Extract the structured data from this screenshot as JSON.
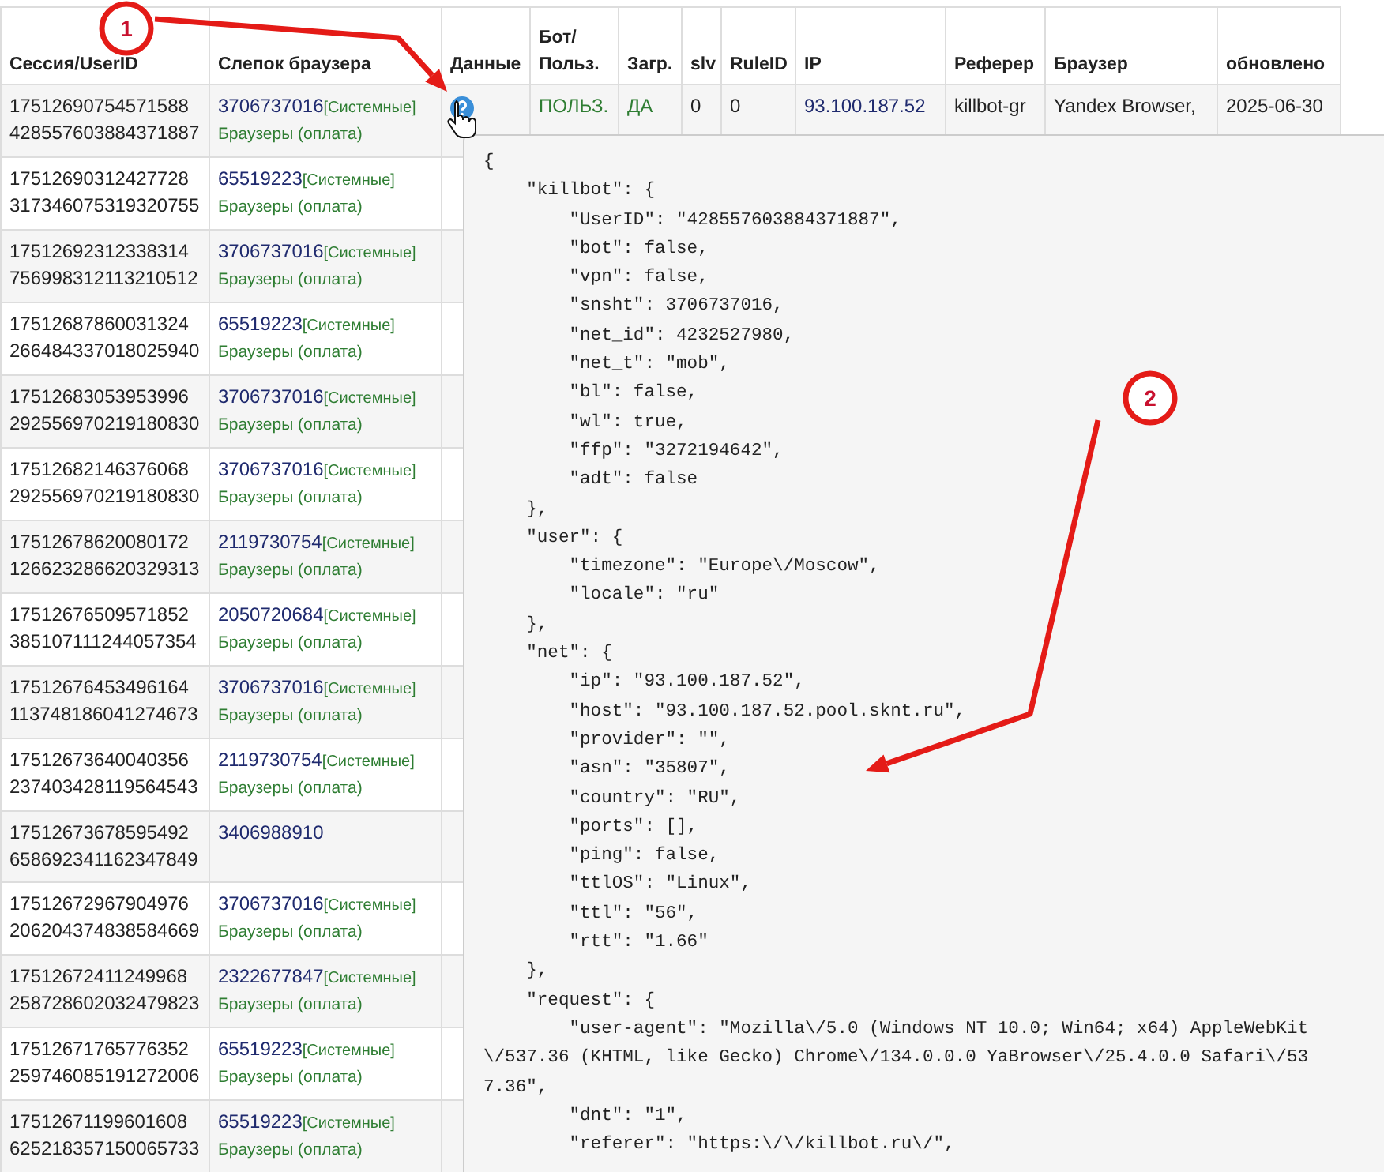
{
  "table": {
    "columns": [
      "Сессия/UserID",
      "Слепок браузера",
      "Данные",
      "Бот/ Польз.",
      "Загр.",
      "slv",
      "RuleID",
      "IP",
      "Реферер",
      "Браузер",
      "обновлено"
    ],
    "rows": [
      {
        "session": "17512690754571588",
        "user_id": "428557603884371887",
        "fingerprint": "3706737016",
        "tag": "[Системные]",
        "category": "Браузеры (оплата)",
        "bot_user": "ПОЛЬЗ.",
        "loaded": "ДА",
        "slv": "0",
        "rule_id": "0",
        "ip": "93.100.187.52",
        "referer": "killbot-gr",
        "browser": "Yandex Browser,",
        "updated": "2025-06-30"
      },
      {
        "session": "17512690312427728",
        "user_id": "317346075319320755",
        "fingerprint": "65519223",
        "tag": "[Системные]",
        "category": "Браузеры (оплата)"
      },
      {
        "session": "17512692312338314",
        "user_id": "756998312113210512",
        "fingerprint": "3706737016",
        "tag": "[Системные]",
        "category": "Браузеры (оплата)"
      },
      {
        "session": "17512687860031324",
        "user_id": "266484337018025940",
        "fingerprint": "65519223",
        "tag": "[Системные]",
        "category": "Браузеры (оплата)"
      },
      {
        "session": "17512683053953996",
        "user_id": "292556970219180830",
        "fingerprint": "3706737016",
        "tag": "[Системные]",
        "category": "Браузеры (оплата)"
      },
      {
        "session": "17512682146376068",
        "user_id": "292556970219180830",
        "fingerprint": "3706737016",
        "tag": "[Системные]",
        "category": "Браузеры (оплата)"
      },
      {
        "session": "17512678620080172",
        "user_id": "126623286620329313",
        "fingerprint": "2119730754",
        "tag": "[Системные]",
        "category": "Браузеры (оплата)"
      },
      {
        "session": "17512676509571852",
        "user_id": "385107111244057354",
        "fingerprint": "2050720684",
        "tag": "[Системные]",
        "category": "Браузеры (оплата)"
      },
      {
        "session": "17512676453496164",
        "user_id": "113748186041274673",
        "fingerprint": "3706737016",
        "tag": "[Системные]",
        "category": "Браузеры (оплата)"
      },
      {
        "session": "17512673640040356",
        "user_id": "237403428119564543",
        "fingerprint": "2119730754",
        "tag": "[Системные]",
        "category": "Браузеры (оплата)"
      },
      {
        "session": "17512673678595492",
        "user_id": "658692341162347849",
        "fingerprint": "3406988910"
      },
      {
        "session": "17512672967904976",
        "user_id": "206204374838584669",
        "fingerprint": "3706737016",
        "tag": "[Системные]",
        "category": "Браузеры (оплата)"
      },
      {
        "session": "17512672411249968",
        "user_id": "258728602032479823",
        "fingerprint": "2322677847",
        "tag": "[Системные]",
        "category": "Браузеры (оплата)"
      },
      {
        "session": "17512671765776352",
        "user_id": "259746085191272006",
        "fingerprint": "65519223",
        "tag": "[Системные]",
        "category": "Браузеры (оплата)"
      },
      {
        "session": "17512671199601608",
        "user_id": "625218357150065733",
        "fingerprint": "65519223",
        "tag": "[Системные]",
        "category": "Браузеры (оплата)"
      }
    ]
  },
  "popup": {
    "lines": [
      "{",
      "    \"killbot\": {",
      "        \"UserID\": \"428557603884371887\",",
      "        \"bot\": false,",
      "        \"vpn\": false,",
      "        \"snsht\": 3706737016,",
      "        \"net_id\": 4232527980,",
      "        \"net_t\": \"mob\",",
      "        \"bl\": false,",
      "        \"wl\": true,",
      "        \"ffp\": \"3272194642\",",
      "        \"adt\": false",
      "    },",
      "    \"user\": {",
      "        \"timezone\": \"Europe\\/Moscow\",",
      "        \"locale\": \"ru\"",
      "    },",
      "    \"net\": {",
      "        \"ip\": \"93.100.187.52\",",
      "        \"host\": \"93.100.187.52.pool.sknt.ru\",",
      "        \"provider\": \"\",",
      "        \"asn\": \"35807\",",
      "        \"country\": \"RU\",",
      "        \"ports\": [],",
      "        \"ping\": false,",
      "        \"ttlOS\": \"Linux\",",
      "        \"ttl\": \"56\",",
      "        \"rtt\": \"1.66\"",
      "    },",
      "    \"request\": {",
      "        \"user-agent\": \"Mozilla\\/5.0 (Windows NT 10.0; Win64; x64) AppleWebKit",
      "\\/537.36 (KHTML, like Gecko) Chrome\\/134.0.0.0 YaBrowser\\/25.4.0.0 Safari\\/53",
      "7.36\",",
      "        \"dnt\": \"1\",",
      "        \"referer\": \"https:\\/\\/killbot.ru\\/\","
    ]
  },
  "annotations": [
    {
      "label": "1"
    },
    {
      "label": "2"
    }
  ]
}
